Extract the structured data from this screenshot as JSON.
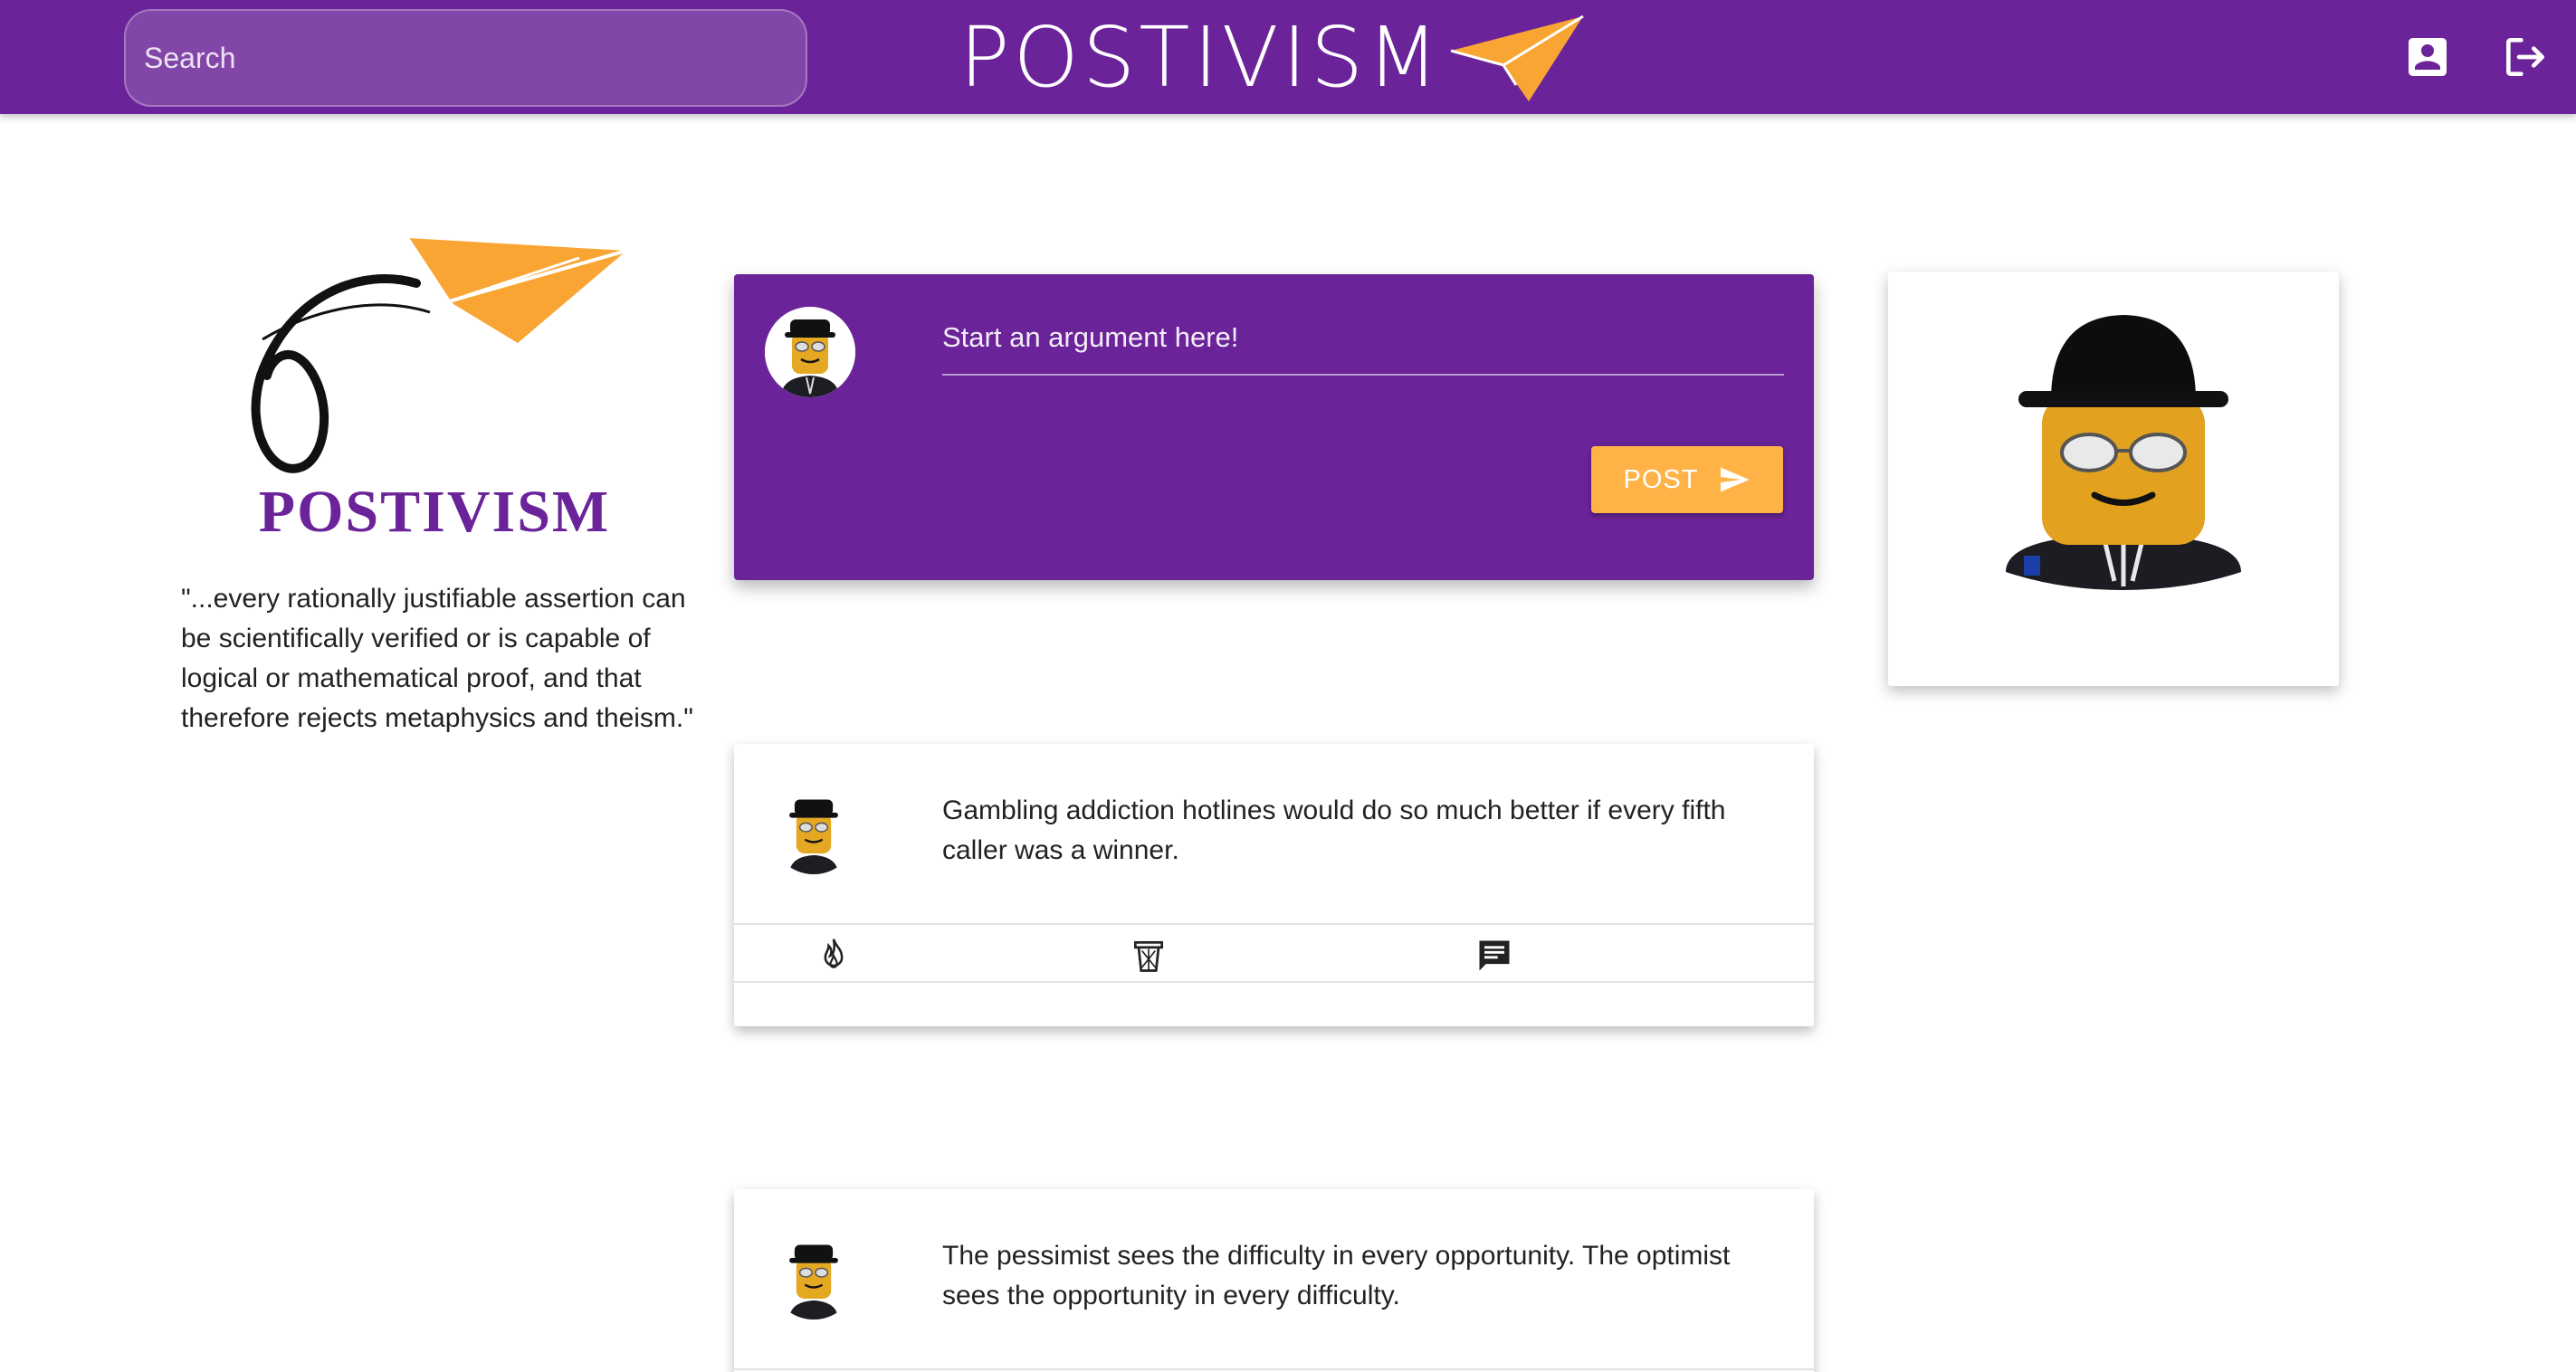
{
  "header": {
    "brand": "POSTIVISM",
    "search_placeholder": "Search"
  },
  "sidebar": {
    "logo_title": "POSTIVISM",
    "quote": "\"...every rationally justifiable assertion can be scientifically verified or is capable of logical or mathematical proof, and that therefore rejects metaphysics and theism.\""
  },
  "composer": {
    "placeholder": "Start an argument here!",
    "post_label": "POST"
  },
  "posts": [
    {
      "text": "Gambling addiction hotlines would do so much better if every fifth caller was a winner."
    },
    {
      "text": "The pessimist sees the difficulty in every opportunity. The optimist sees the opportunity in every difficulty."
    }
  ],
  "colors": {
    "primary": "#6a2398",
    "accent": "#ffb347",
    "plane": "#f9a533"
  },
  "icons": {
    "profile": "account-box-icon",
    "logout": "logout-icon",
    "send": "send-icon",
    "like": "flame-icon",
    "delete": "trash-icon",
    "comment": "comment-icon"
  }
}
